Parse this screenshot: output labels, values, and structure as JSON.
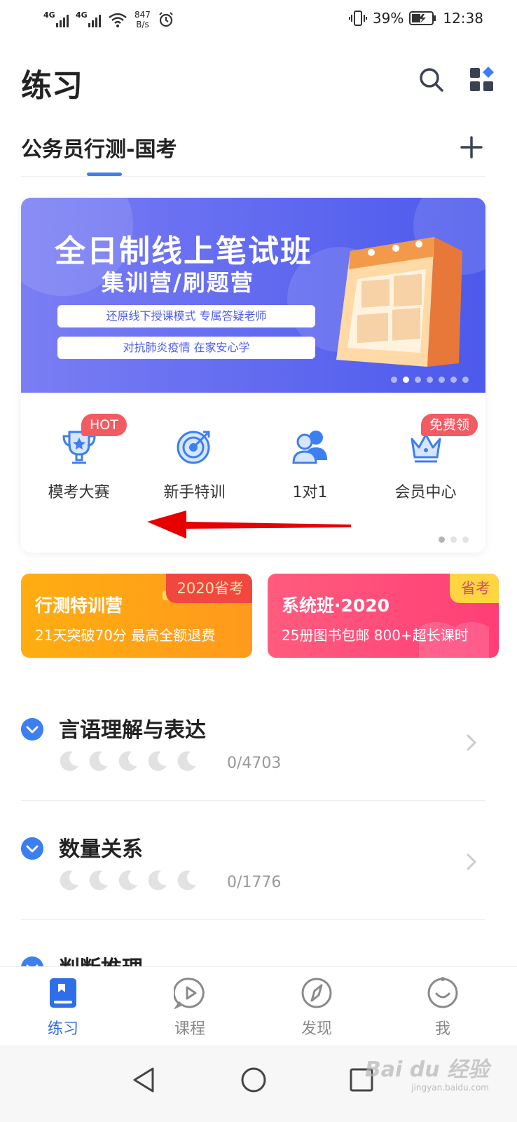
{
  "status_bar": {
    "network_1": "4G",
    "network_2": "4G",
    "net_speed_value": "847",
    "net_speed_unit": "B/s",
    "battery_percent": "39%",
    "time": "12:38"
  },
  "header": {
    "title": "练习",
    "search_icon": "search-icon",
    "apps_icon": "apps-grid-icon"
  },
  "tabs": {
    "active_label": "公务员行测-国考",
    "add_icon": "plus-icon"
  },
  "banner": {
    "title": "全日制线上笔试班",
    "subtitle": "集训营/刷题营",
    "pill_1": "还原线下授课模式 专属答疑老师",
    "pill_2": "对抗肺炎疫情 在家安心学",
    "dot_count": 7,
    "active_dot": 1
  },
  "quick_entries": [
    {
      "label": "模考大赛",
      "badge": "HOT",
      "icon": "trophy-icon"
    },
    {
      "label": "新手特训",
      "badge": "",
      "icon": "target-icon"
    },
    {
      "label": "1对1",
      "badge": "",
      "icon": "tutor-icon"
    },
    {
      "label": "会员中心",
      "badge": "免费领",
      "icon": "crown-icon"
    }
  ],
  "promos": [
    {
      "title": "行测特训营",
      "subtitle": "21天突破70分 最高全额退费",
      "tag": "2020省考"
    },
    {
      "title": "系统班·2020",
      "subtitle": "25册图书包邮 800+超长课时",
      "tag": "省考"
    }
  ],
  "practice_items": [
    {
      "title": "言语理解与表达",
      "count": "0/4703"
    },
    {
      "title": "数量关系",
      "count": "0/1776"
    },
    {
      "title": "判断推理",
      "count": ""
    }
  ],
  "bottom_nav": [
    {
      "label": "练习",
      "icon": "book-icon",
      "active": true
    },
    {
      "label": "课程",
      "icon": "play-bubble-icon",
      "active": false
    },
    {
      "label": "发现",
      "icon": "compass-icon",
      "active": false
    },
    {
      "label": "我",
      "icon": "smile-icon",
      "active": false
    }
  ],
  "watermark": {
    "text": "Bai du 经验",
    "sub": "jingyan.baidu.com"
  },
  "colors": {
    "accent": "#3c7ff0",
    "banner_bg": "#5e67ef",
    "badge_red": "#f15b61",
    "promo_orange": "#ffa516",
    "promo_pink": "#ff4e7a"
  }
}
